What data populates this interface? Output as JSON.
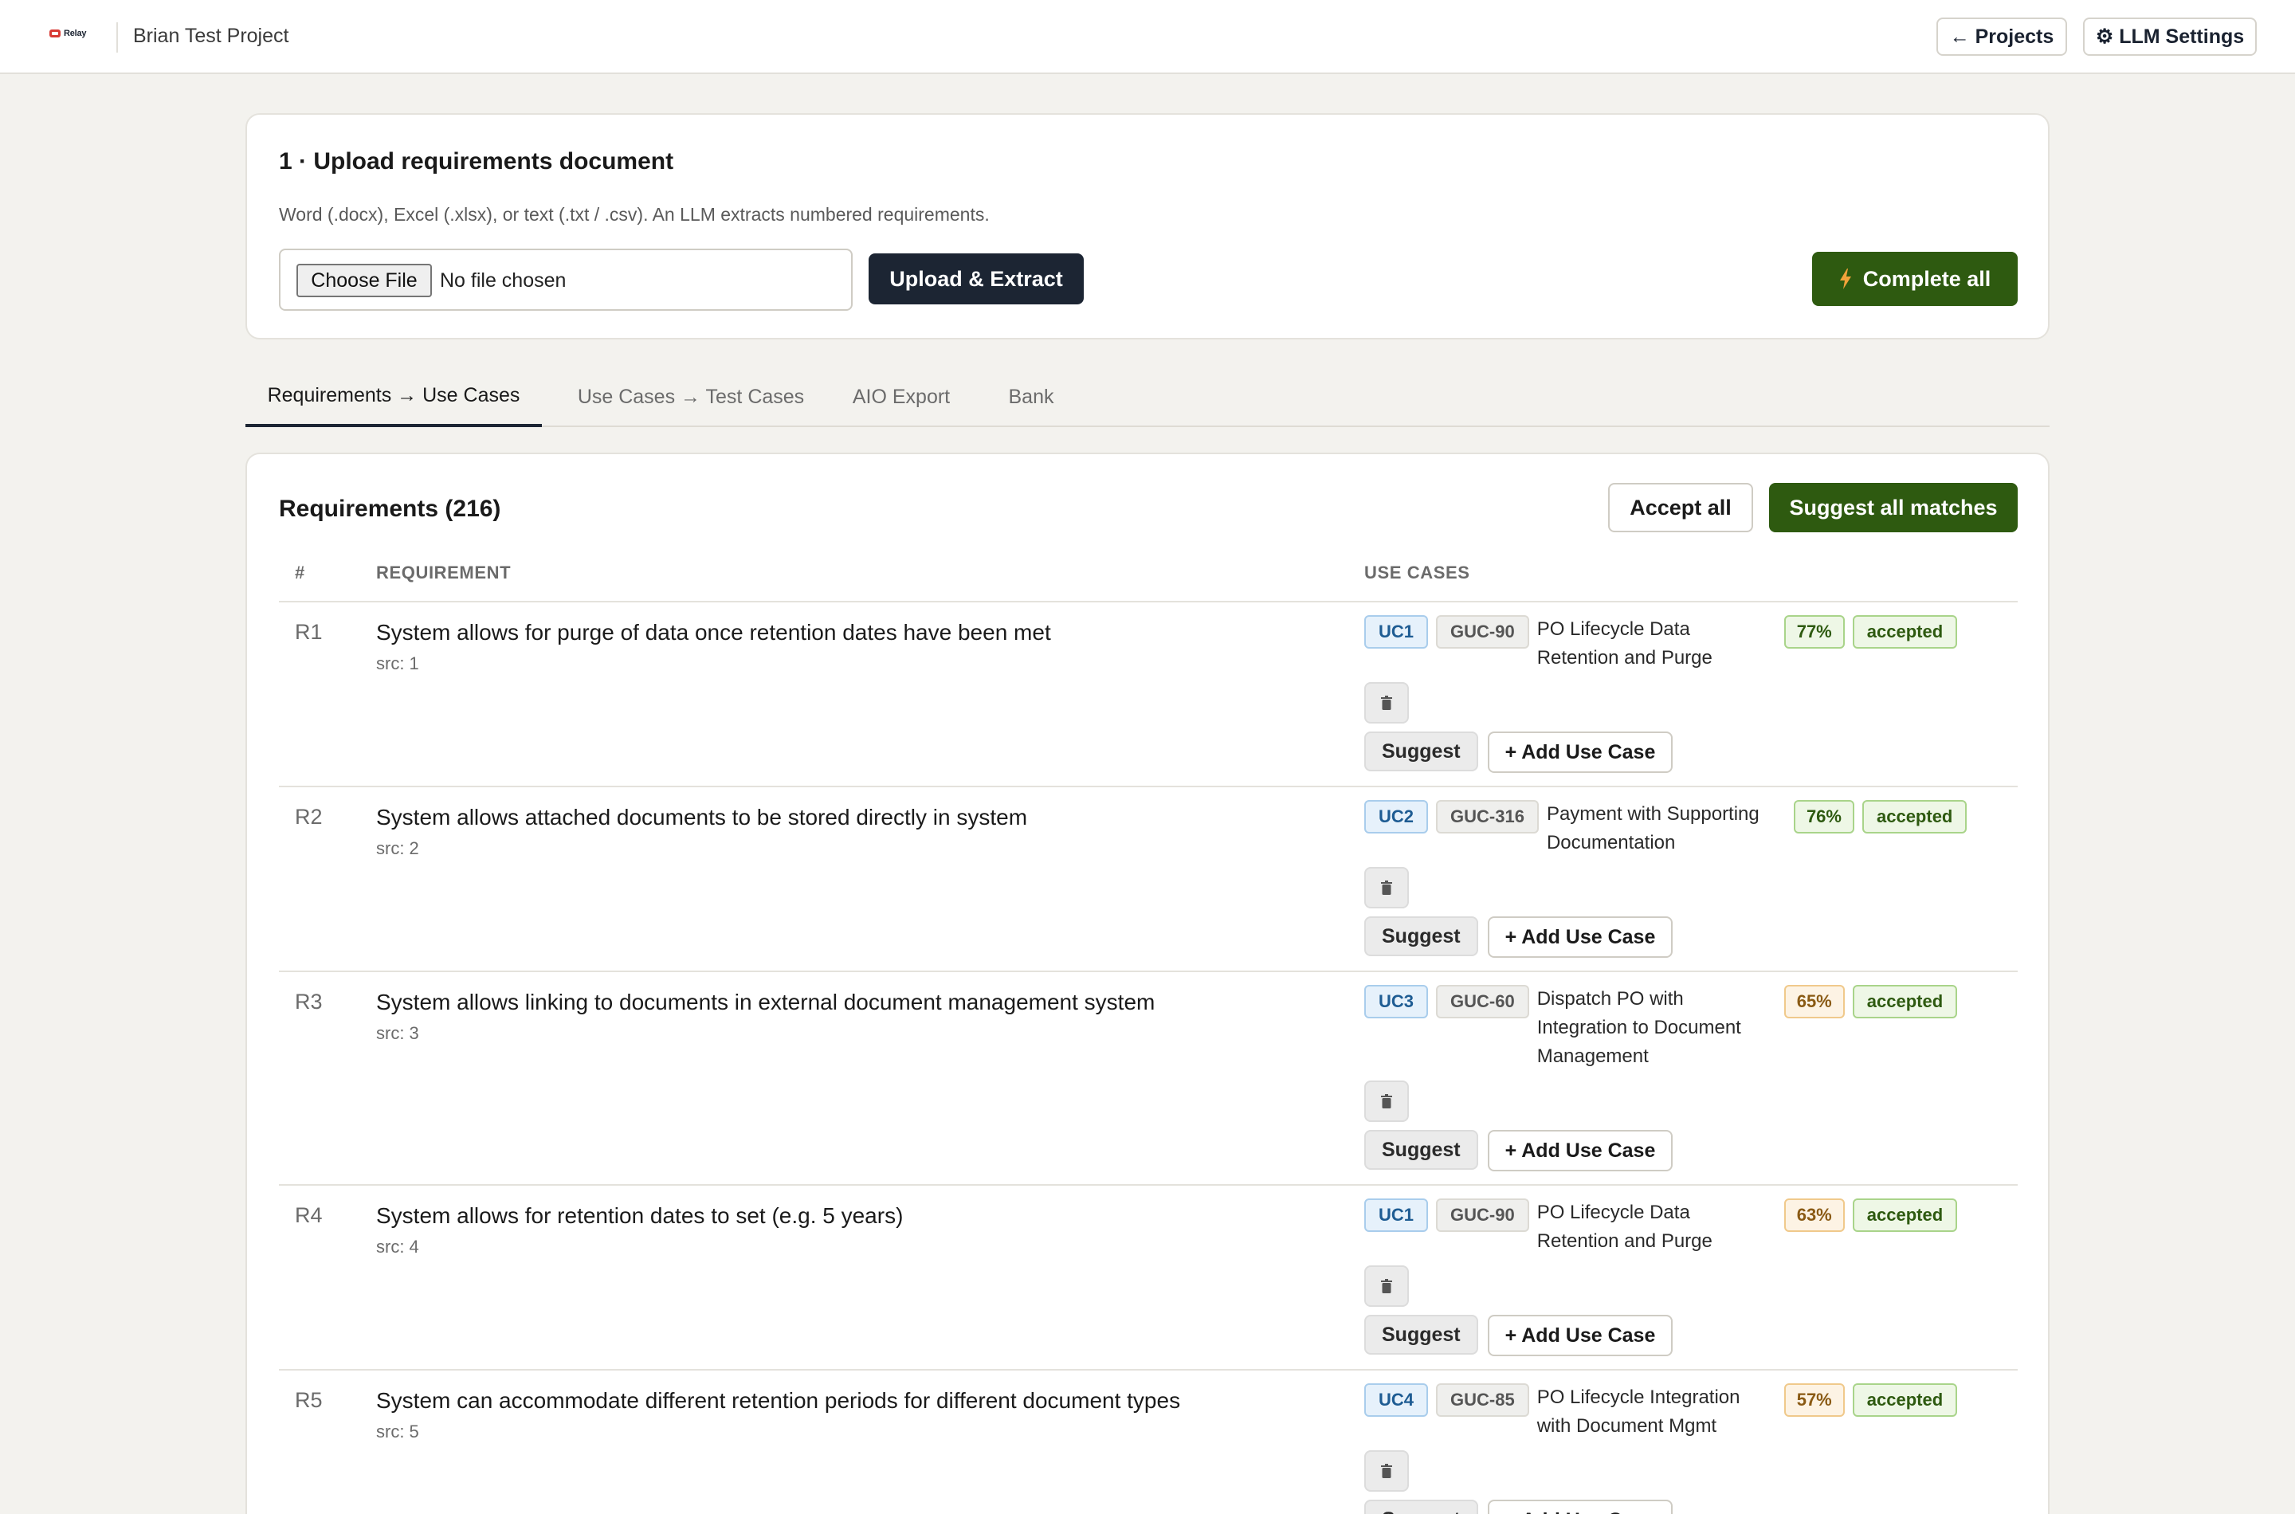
{
  "header": {
    "logo_text": "Relay",
    "project_name": "Brian Test Project",
    "projects_button": "← Projects",
    "llm_settings_button": "⚙ LLM Settings"
  },
  "upload": {
    "title": "1 · Upload requirements document",
    "description": "Word (.docx), Excel (.xlsx), or text (.txt / .csv). An LLM extracts numbered requirements.",
    "choose_file_label": "Choose File",
    "file_status": "No file chosen",
    "upload_button": "Upload & Extract",
    "complete_all_button": "Complete all"
  },
  "tabs": [
    {
      "label": "Requirements → Use Cases",
      "active": true
    },
    {
      "label": "Use Cases → Test Cases",
      "active": false
    },
    {
      "label": "AIO Export",
      "active": false
    },
    {
      "label": "Bank",
      "active": false
    }
  ],
  "requirements": {
    "title": "Requirements (216)",
    "accept_all_button": "Accept all",
    "suggest_all_button": "Suggest all matches",
    "columns": {
      "num": "#",
      "requirement": "REQUIREMENT",
      "use_cases": "USE CASES"
    },
    "suggest_label": "Suggest",
    "add_use_case_label": "+ Add Use Case",
    "rows": [
      {
        "id": "R1",
        "text": "System allows for purge of data once retention dates have been met",
        "src": "src: 1",
        "uc": "UC1",
        "guc": "GUC-90",
        "uc_name": "PO Lifecycle Data Retention and Purge",
        "pct": "77%",
        "pct_level": "green",
        "status": "accepted"
      },
      {
        "id": "R2",
        "text": "System allows attached documents to be stored directly in system",
        "src": "src: 2",
        "uc": "UC2",
        "guc": "GUC-316",
        "uc_name": "Payment with Supporting Documentation",
        "pct": "76%",
        "pct_level": "green",
        "status": "accepted"
      },
      {
        "id": "R3",
        "text": "System allows linking to documents in external document management system",
        "src": "src: 3",
        "uc": "UC3",
        "guc": "GUC-60",
        "uc_name": "Dispatch PO with Integration to Document Management",
        "pct": "65%",
        "pct_level": "orange",
        "status": "accepted"
      },
      {
        "id": "R4",
        "text": "System allows for retention dates to set (e.g. 5 years)",
        "src": "src: 4",
        "uc": "UC1",
        "guc": "GUC-90",
        "uc_name": "PO Lifecycle Data Retention and Purge",
        "pct": "63%",
        "pct_level": "orange",
        "status": "accepted"
      },
      {
        "id": "R5",
        "text": "System can accommodate different retention periods for different document types",
        "src": "src: 5",
        "uc": "UC4",
        "guc": "GUC-85",
        "uc_name": "PO Lifecycle Integration with Document Mgmt",
        "pct": "57%",
        "pct_level": "orange",
        "status": "accepted"
      }
    ]
  },
  "colors": {
    "primary_dark": "#1c2533",
    "accent_green": "#2e5a10",
    "background": "#f3f2ee"
  }
}
